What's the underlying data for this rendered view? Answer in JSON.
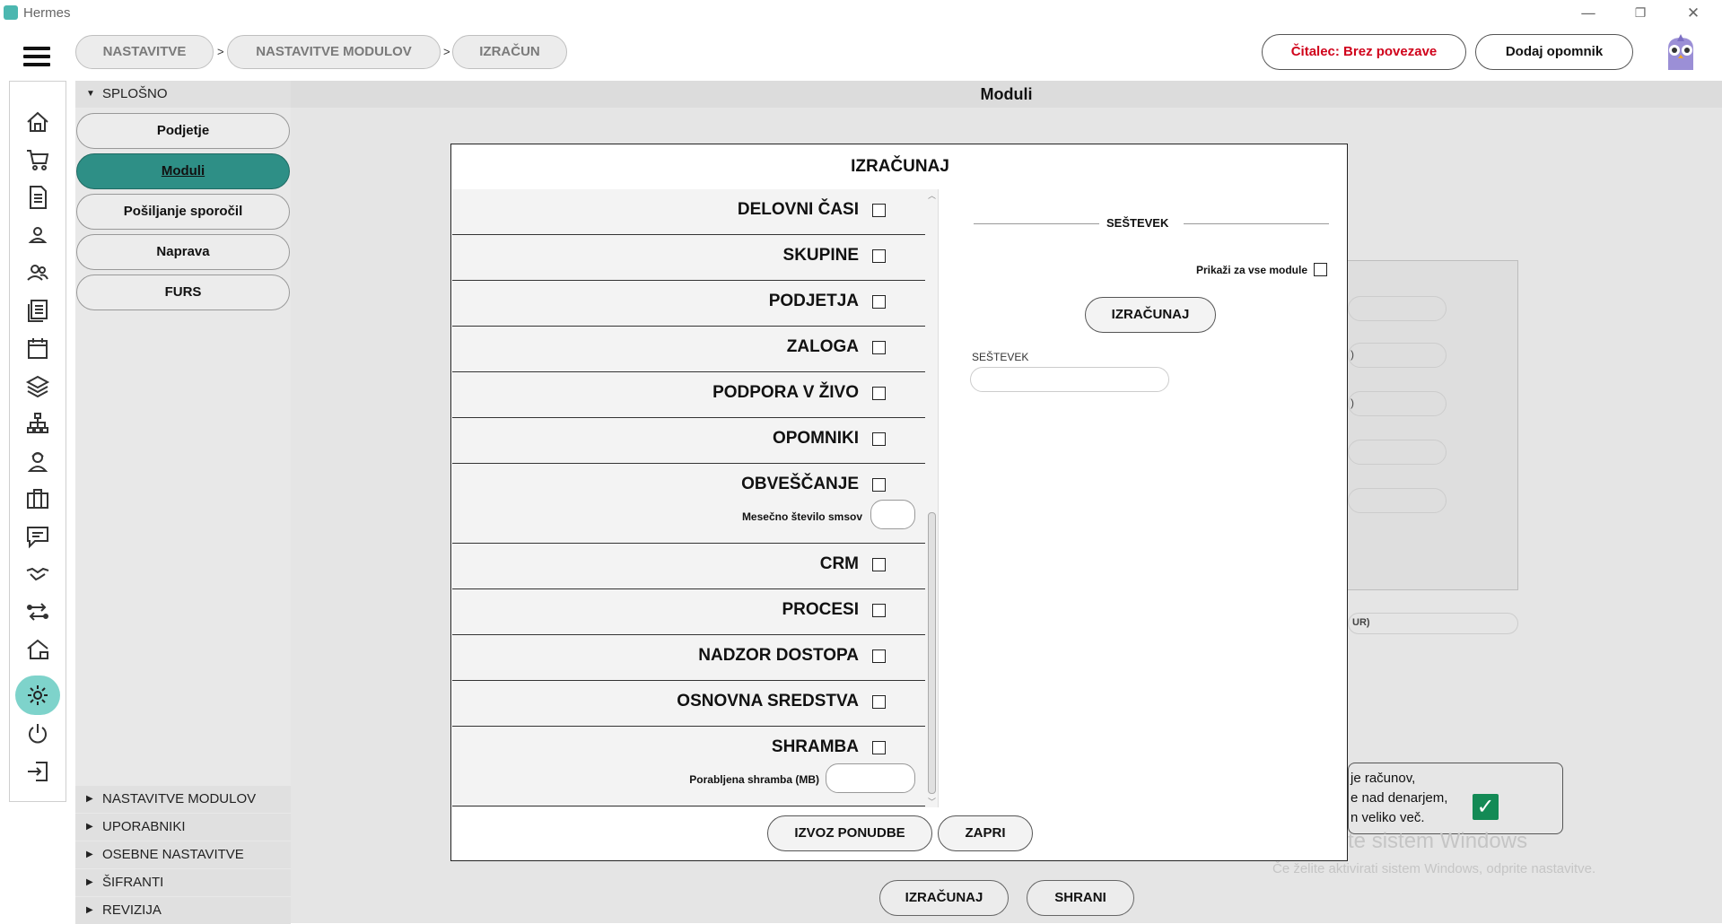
{
  "window": {
    "title": "Hermes",
    "minimize": "—",
    "restore": "❐",
    "close": "✕"
  },
  "breadcrumb": [
    {
      "label": "NASTAVITVE"
    },
    {
      "label": "NASTAVITVE MODULOV"
    },
    {
      "label": "IZRAČUN"
    }
  ],
  "breadcrumb_separator": ">",
  "header": {
    "reader_status": "Čitalec: Brez povezave",
    "add_reminder": "Dodaj opomnik",
    "reader_status_color": "#d0021b"
  },
  "sidebar": {
    "general_section": "SPLOŠNO",
    "items": [
      {
        "label": "Podjetje"
      },
      {
        "label": "Moduli"
      },
      {
        "label": "Pošiljanje sporočil"
      },
      {
        "label": "Naprava"
      },
      {
        "label": "FURS"
      }
    ],
    "sections": [
      {
        "label": "NASTAVITVE MODULOV"
      },
      {
        "label": "UPORABNIKI"
      },
      {
        "label": "OSEBNE NASTAVITVE"
      },
      {
        "label": "ŠIFRANTI"
      },
      {
        "label": "REVIZIJA"
      }
    ]
  },
  "rail_icons": [
    "home-icon",
    "cart-icon",
    "document-icon",
    "user-icon",
    "users-icon",
    "list-icon",
    "calendar-icon",
    "layers-icon",
    "network-icon",
    "worker-icon",
    "briefcase-icon",
    "chat-icon",
    "handshake-icon",
    "transfer-icon",
    "house-icon",
    "settings-icon",
    "power-icon",
    "logout-icon"
  ],
  "main": {
    "title": "Moduli",
    "background_text_1": "je računov,",
    "background_text_2": "e nad denarjem,",
    "background_text_3": "n veliko več.",
    "background_field_fragment": "UR)",
    "background_paren_1": ")",
    "background_paren_2": ")"
  },
  "bottom_bar": {
    "calculate": "IZRAČUNAJ",
    "save": "SHRANI"
  },
  "watermark": {
    "line1": "Aktivirajte sistem Windows",
    "line2": "Če želite aktivirati sistem Windows, odprite nastavitve."
  },
  "modal": {
    "title": "IZRAČUNAJ",
    "modules": [
      {
        "label": "DELOVNI ČASI"
      },
      {
        "label": "SKUPINE"
      },
      {
        "label": "PODJETJA"
      },
      {
        "label": "ZALOGA"
      },
      {
        "label": "PODPORA V ŽIVO"
      },
      {
        "label": "OPOMNIKI"
      },
      {
        "label": "OBVEŠČANJE",
        "sub_label": "Mesečno število smsov",
        "sub_value": ""
      },
      {
        "label": "CRM"
      },
      {
        "label": "PROCESI"
      },
      {
        "label": "NADZOR DOSTOPA"
      },
      {
        "label": "OSNOVNA SREDSTVA"
      },
      {
        "label": "SHRAMBA",
        "sub_label": "Porabljena shramba (MB)",
        "sub_value": ""
      }
    ],
    "summary_heading": "SEŠTEVEK",
    "show_all_label": "Prikaži za vse module",
    "calculate_button": "IZRAČUNAJ",
    "sum_field_label": "SEŠTEVEK",
    "sum_field_value": "",
    "export_button": "IZVOZ PONUDBE",
    "close_button": "ZAPRI"
  }
}
